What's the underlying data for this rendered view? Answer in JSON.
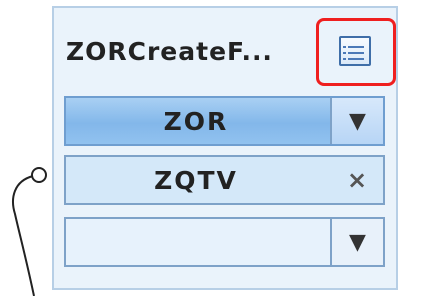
{
  "node": {
    "title": "ZORCreateF...",
    "fields": [
      {
        "label": "ZOR",
        "button_symbol": "▼"
      },
      {
        "label": "ZQTV",
        "button_symbol": "×"
      },
      {
        "label": "",
        "button_symbol": "▼"
      }
    ]
  },
  "icons": {
    "table": "table-icon",
    "dropdown": "chevron-down-icon",
    "clear": "close-icon",
    "connector": "connector-dot-icon"
  },
  "colors": {
    "panel_bg": "#eaf3fb",
    "panel_border": "#b7cfe6",
    "active_field": "#83b7ea",
    "highlight_border": "#ef1f1f",
    "icon_blue": "#3f6ea8"
  }
}
